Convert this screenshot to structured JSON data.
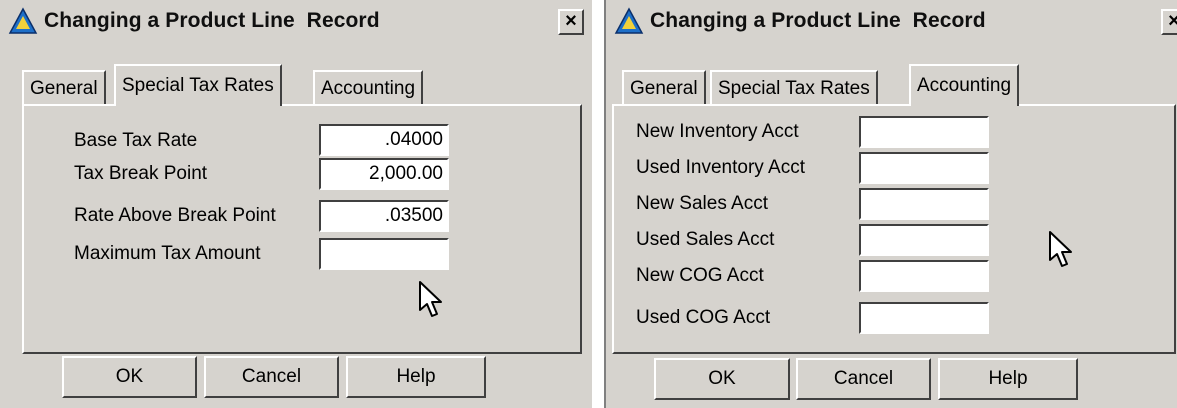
{
  "windows": [
    {
      "title": "Changing a Product Line  Record",
      "close_glyph": "×",
      "tabs": [
        {
          "label": "General",
          "active": false
        },
        {
          "label": "Special Tax Rates",
          "active": true
        },
        {
          "label": "Accounting",
          "active": false
        }
      ],
      "fields": [
        {
          "label": "Base Tax Rate",
          "value": ".04000"
        },
        {
          "label": "Tax Break Point",
          "value": "2,000.00"
        },
        {
          "label": "Rate Above Break Point",
          "value": ".03500"
        },
        {
          "label": "Maximum Tax Amount",
          "value": ""
        }
      ],
      "buttons": {
        "ok": "OK",
        "cancel": "Cancel",
        "help": "Help"
      }
    },
    {
      "title": "Changing a Product Line  Record",
      "close_glyph": "×",
      "tabs": [
        {
          "label": "General",
          "active": false
        },
        {
          "label": "Special Tax Rates",
          "active": false
        },
        {
          "label": "Accounting",
          "active": true
        }
      ],
      "fields": [
        {
          "label": "New Inventory Acct",
          "value": ""
        },
        {
          "label": "Used Inventory Acct",
          "value": ""
        },
        {
          "label": "New Sales Acct",
          "value": ""
        },
        {
          "label": "Used Sales Acct",
          "value": ""
        },
        {
          "label": "New COG Acct",
          "value": ""
        },
        {
          "label": "Used COG Acct",
          "value": ""
        }
      ],
      "buttons": {
        "ok": "OK",
        "cancel": "Cancel",
        "help": "Help"
      }
    }
  ],
  "icons": {
    "app": "app-triangle-icon",
    "cursor": "mouse-pointer-icon"
  },
  "colors": {
    "face": "#d6d3ce",
    "highlight": "#ffffff",
    "shadow": "#404040",
    "icon_blue": "#1e6fc8"
  }
}
